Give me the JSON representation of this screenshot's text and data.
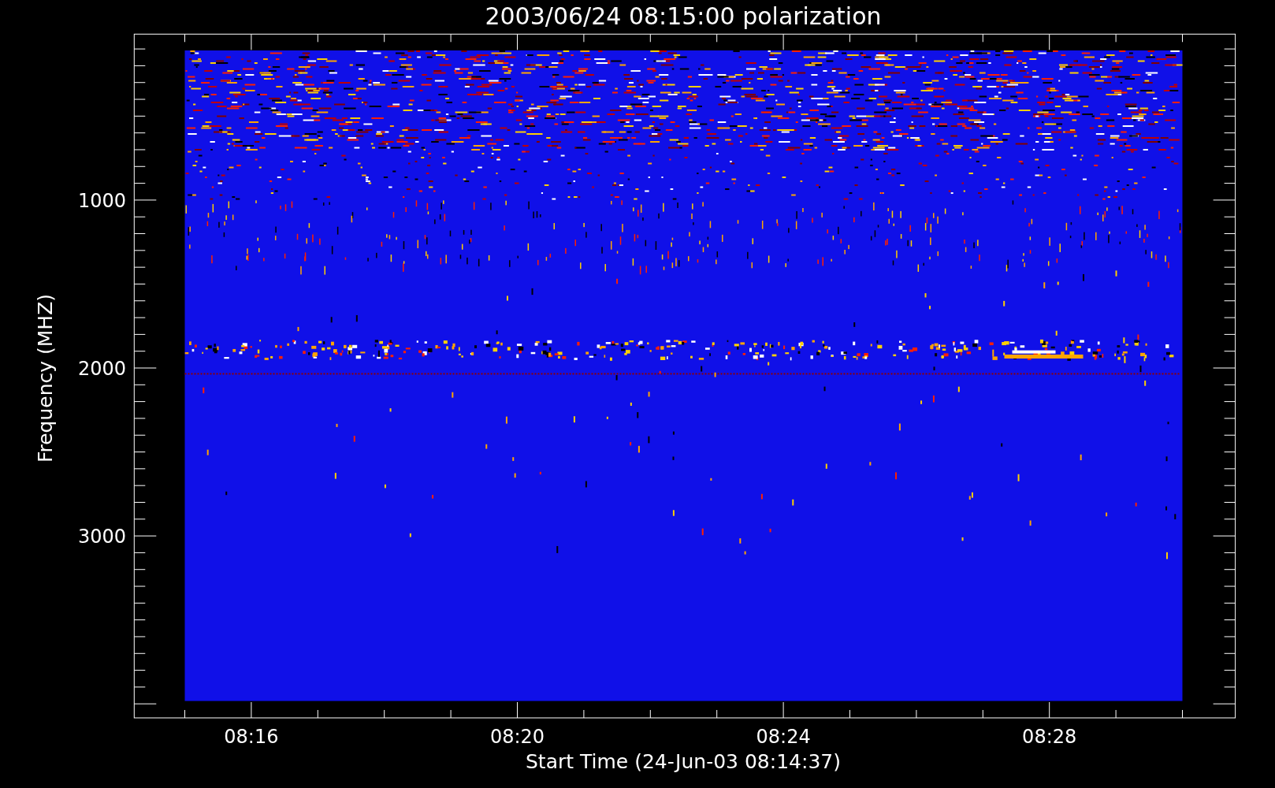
{
  "title": "2003/06/24 08:15:00 polarization",
  "x_axis": {
    "label": "Start Time (24-Jun-03 08:14:37)",
    "ticks": [
      "08:16",
      "08:20",
      "08:24",
      "08:28"
    ]
  },
  "y_axis": {
    "label": "Frequency (MHZ)",
    "ticks": [
      "1000",
      "2000",
      "3000"
    ]
  }
}
